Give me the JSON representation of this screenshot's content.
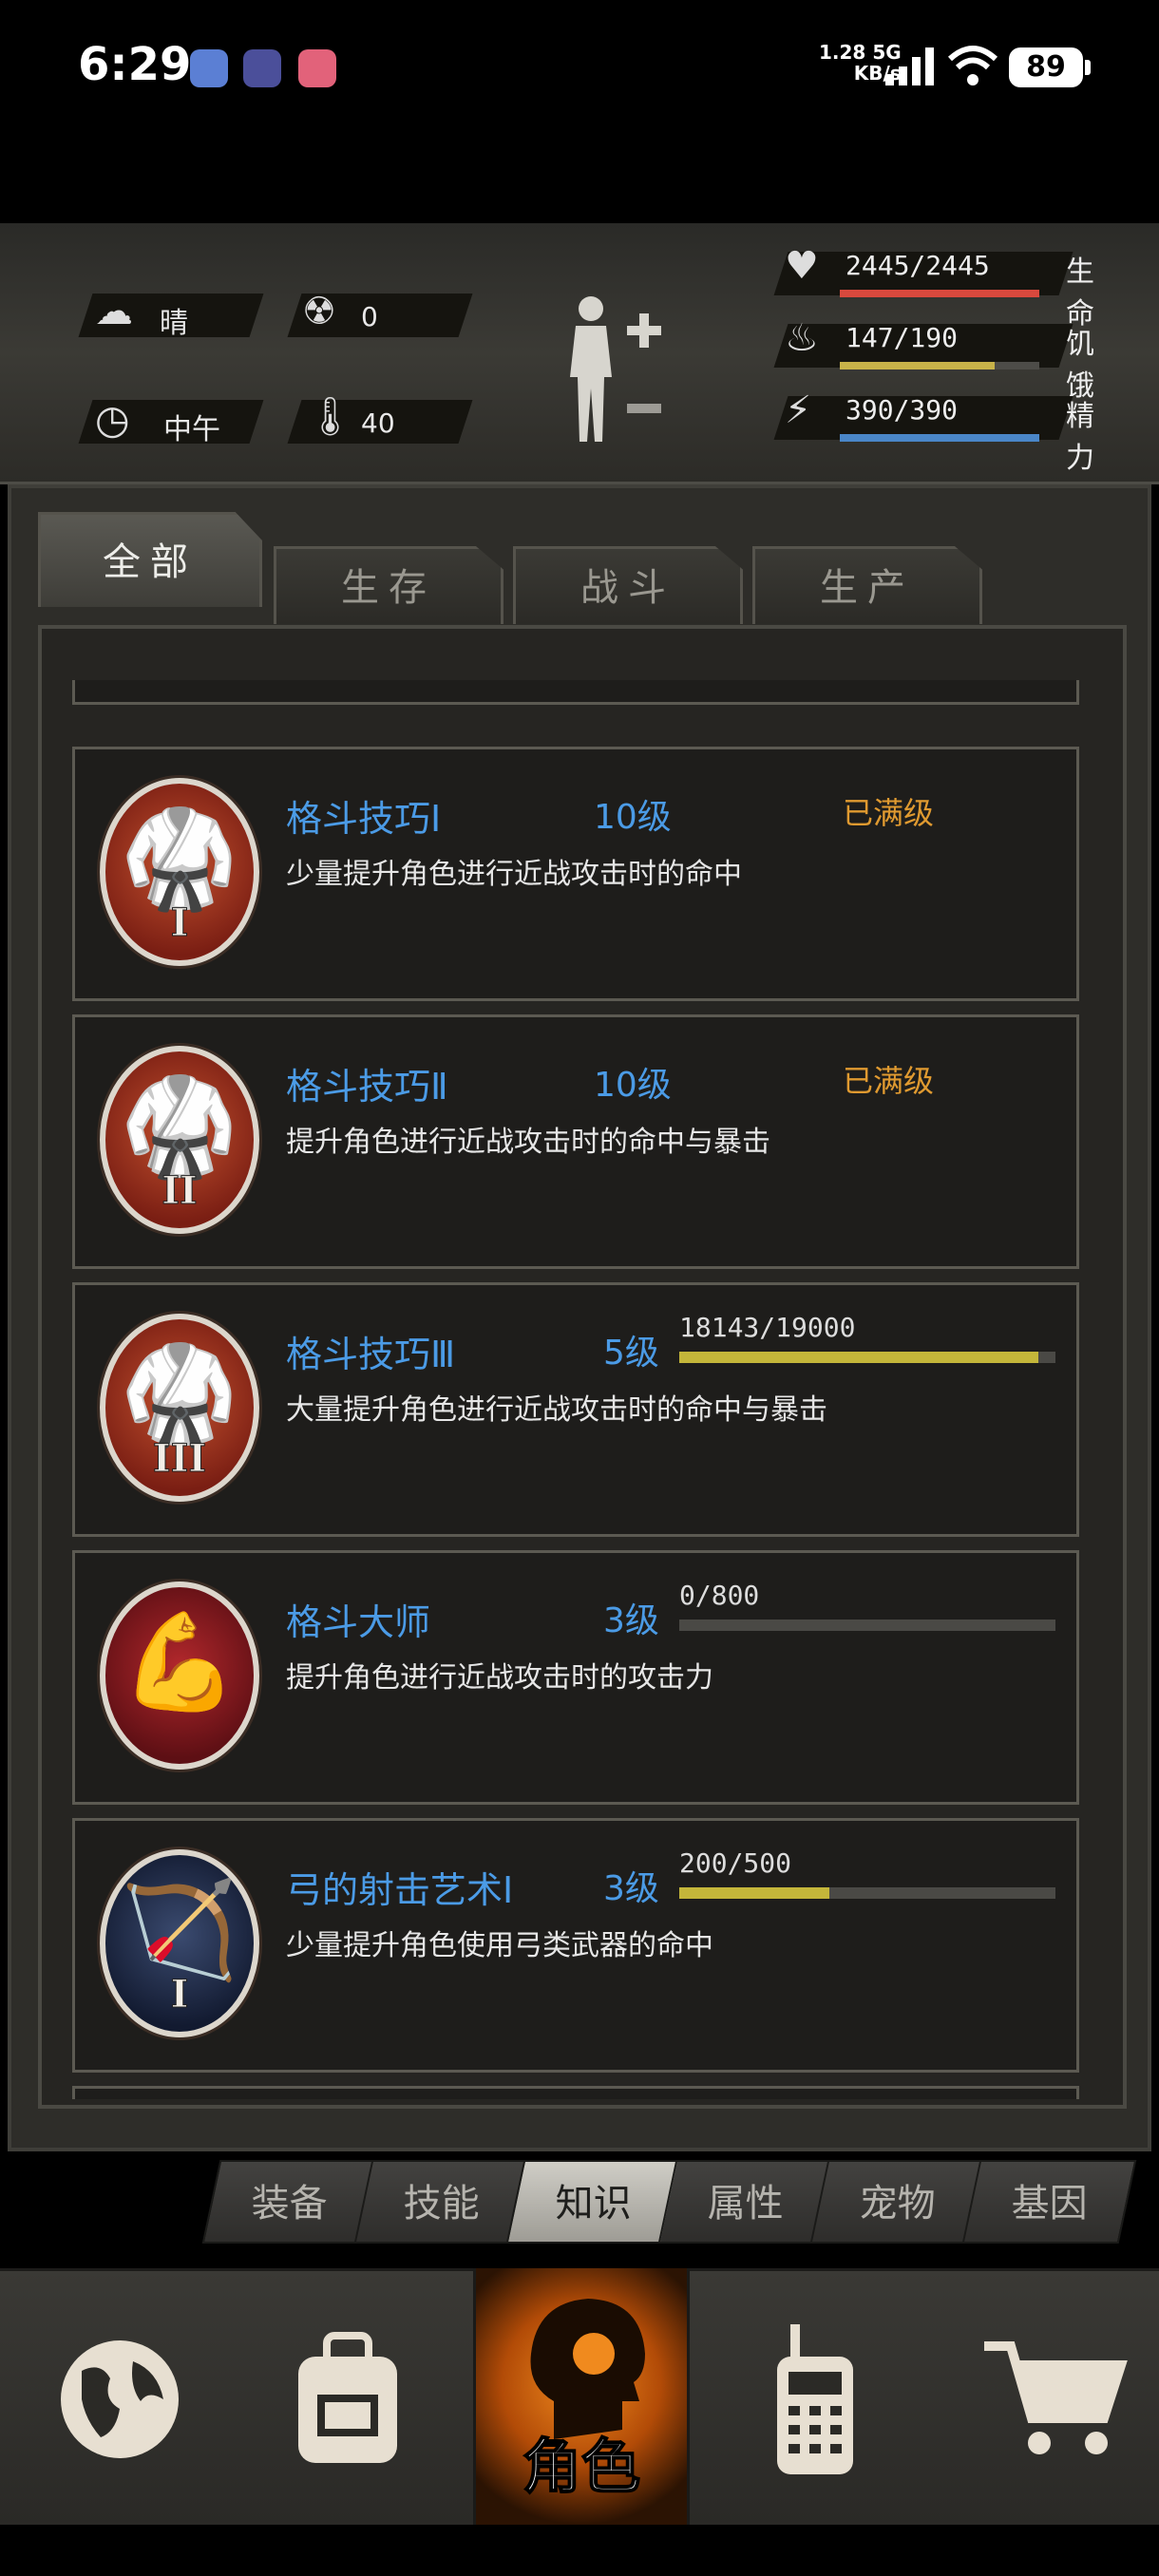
{
  "status_bar": {
    "time": "6:29",
    "net_speed": "1.28",
    "net_unit": "KB/s",
    "net_type": "5G",
    "battery": "89"
  },
  "hud": {
    "weather": "晴",
    "radiation": "0",
    "time_of_day": "中午",
    "temperature": "40",
    "stats": [
      {
        "value": "2445/2445",
        "label": "生命",
        "fraction": 1.0,
        "color": "#d9493d",
        "icon": "heart-pulse-icon"
      },
      {
        "value": "147/190",
        "label": "饥饿",
        "fraction": 0.774,
        "color": "#c7b249",
        "icon": "stomach-icon"
      },
      {
        "value": "390/390",
        "label": "精力",
        "fraction": 1.0,
        "color": "#4a86c8",
        "icon": "head-bolt-icon"
      }
    ]
  },
  "category_tabs": [
    "全部",
    "生存",
    "战斗",
    "生产"
  ],
  "active_category_tab": "全部",
  "skills": [
    {
      "name": "格斗技巧Ⅰ",
      "level": "10级",
      "status": "已满级",
      "desc": "少量提升角色进行近战攻击时的命中",
      "roman": "I",
      "badge": "orange",
      "icon": "martial-arts-icon"
    },
    {
      "name": "格斗技巧Ⅱ",
      "level": "10级",
      "status": "已满级",
      "desc": "提升角色进行近战攻击时的命中与暴击",
      "roman": "II",
      "badge": "orange",
      "icon": "martial-arts-icon"
    },
    {
      "name": "格斗技巧Ⅲ",
      "level": "5级",
      "progress_text": "18143/19000",
      "progress": 0.955,
      "desc": "大量提升角色进行近战攻击时的命中与暴击",
      "roman": "III",
      "badge": "orange",
      "icon": "martial-arts-icon"
    },
    {
      "name": "格斗大师",
      "level": "3级",
      "progress_text": "0/800",
      "progress": 0.0,
      "desc": "提升角色进行近战攻击时的攻击力",
      "roman": "",
      "badge": "red",
      "icon": "muscle-torso-icon"
    },
    {
      "name": "弓的射击艺术Ⅰ",
      "level": "3级",
      "progress_text": "200/500",
      "progress": 0.4,
      "desc": "少量提升角色使用弓类武器的命中",
      "roman": "I",
      "badge": "blue",
      "icon": "archer-icon"
    }
  ],
  "sub_tabs": [
    "装备",
    "技能",
    "知识",
    "属性",
    "宠物",
    "基因"
  ],
  "active_sub_tab": "知识",
  "bottom_nav": {
    "items": [
      "globe-icon",
      "backpack-icon",
      "character-head-icon",
      "radio-icon",
      "cart-icon"
    ],
    "active_label": "角色"
  },
  "colors": {
    "skill_name": "#4b9be6",
    "max_level": "#e09a30",
    "progress_fill": "#c4b63a",
    "nav_active": "#f08a1e"
  }
}
